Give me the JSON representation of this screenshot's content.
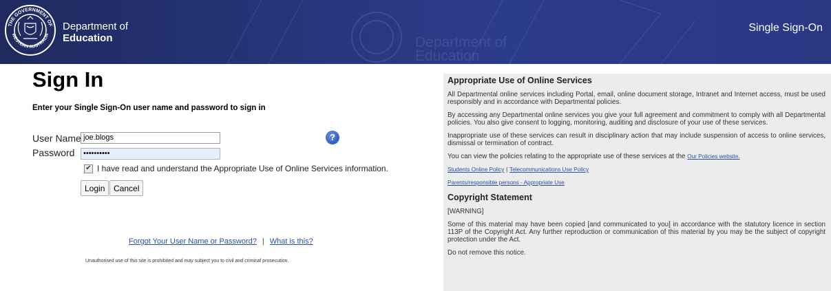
{
  "header": {
    "dept_line1": "Department of",
    "dept_line2": "Education",
    "app_name": "Single Sign-On",
    "crest_top_text": "THE GOVERNMENT OF",
    "crest_bottom_text": "WESTERN AUSTRALIA"
  },
  "signin": {
    "title": "Sign In",
    "intro": "Enter your Single Sign-On user name and password to sign in",
    "username_label": "User Name",
    "username_value": "joe.blogs",
    "password_label": "Password",
    "password_value": "joeblogs12",
    "help_glyph": "?",
    "checkbox_checked": true,
    "checkbox_label": "I have read and understand the Appropriate Use of Online Services information.",
    "login_label": "Login",
    "cancel_label": "Cancel",
    "forgot_link": "Forgot Your User Name or Password?",
    "separator": "|",
    "what_link": "What is this?",
    "legal_notice": "Unauthorised use of this site is prohibited and may subject you to civil and criminal prosecution."
  },
  "policy": {
    "heading": "Appropriate Use of Online Services",
    "p1": "All Departmental online services including Portal, email, online document storage, Intranet and Internet access, must be used responsibly and in accordance with Departmental policies.",
    "p2": "By accessing any Departmental online services you give your full agreement and commitment to comply with all Departmental policies. You also give consent to logging, monitoring, auditing and disclosure of your use of these services.",
    "p3": "Inappropriate use of these services can result in disciplinary action that may include suspension of access to online services, dismissal or termination of contract.",
    "p4_text": "You can view the policies relating to the appropriate use of these services at the",
    "p4_link": "Our Policies website.",
    "link_students": "Students Online Policy",
    "link_sep": "|",
    "link_telecom": "Telecommunications Use Policy",
    "link_parents": "Parents/responsible persons - Appropriate Use",
    "copyright_heading": "Copyright Statement",
    "warning": "[WARNING]",
    "copyright_text": "Some of this material may have been copied [and communicated to you] in accordance with the statutory licence in section 113P of the Copyright Act. Any further reproduction or communication of this material by you may be the subject of copyright protection under the Act.",
    "do_not_remove": "Do not remove this notice."
  },
  "colors": {
    "header_blue": "#2a3884",
    "link_blue": "#2a4da8",
    "panel_grey": "#ececec"
  }
}
